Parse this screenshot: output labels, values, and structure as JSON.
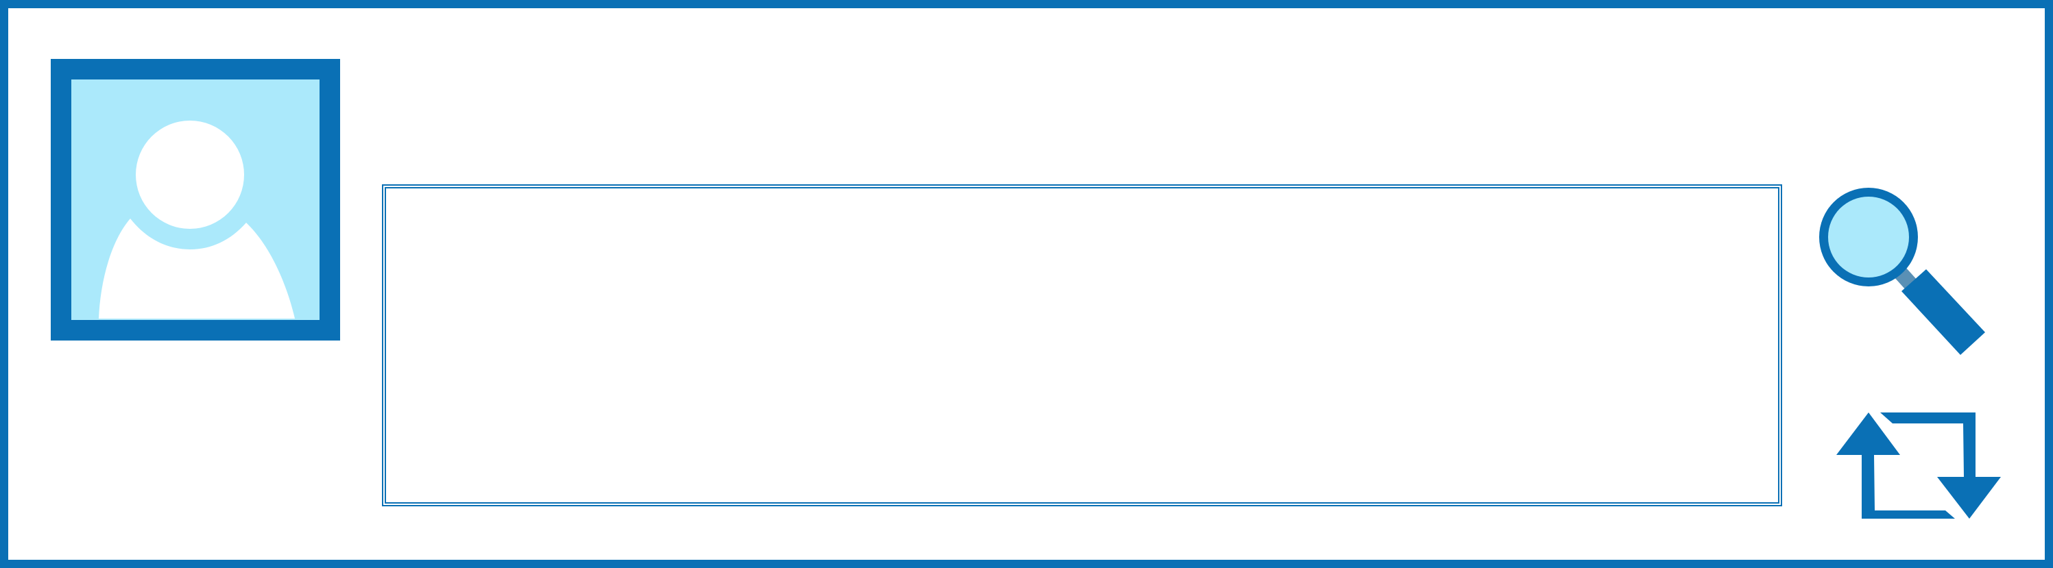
{
  "colors": {
    "accent": "#0a70b5",
    "avatar_background": "#abe9fb",
    "avatar_figure": "#ffffff",
    "lens_glass": "#abe9fb",
    "handle_joint": "#5a90b5"
  },
  "avatar": {
    "icon": "user-silhouette-icon"
  },
  "text_area": {
    "value": ""
  },
  "actions": [
    {
      "icon": "search-icon"
    },
    {
      "icon": "refresh-icon"
    }
  ]
}
